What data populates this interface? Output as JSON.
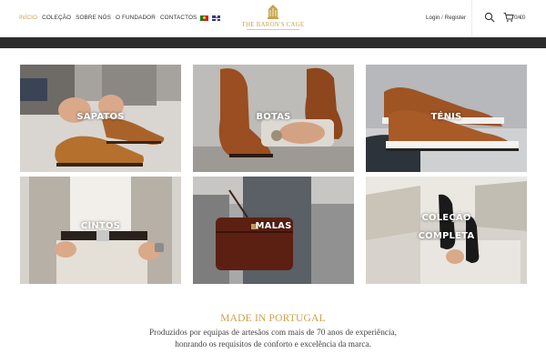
{
  "nav": {
    "items": [
      {
        "label": "Início",
        "active": true
      },
      {
        "label": "Coleção",
        "active": false
      },
      {
        "label": "Sobre Nós",
        "active": false
      },
      {
        "label": "O Fundador",
        "active": false
      },
      {
        "label": "Contactos",
        "active": false
      }
    ],
    "flags": [
      "pt-flag-icon",
      "uk-flag-icon"
    ]
  },
  "logo": {
    "text": "THE BARON'S CAGE",
    "icon": "birdcage-crest-icon"
  },
  "account": {
    "login": "Login",
    "separator": "/",
    "register": "Register"
  },
  "cart": {
    "count": "0",
    "separator": "/",
    "total": "€0",
    "icon": "cart-icon"
  },
  "search": {
    "icon": "search-icon"
  },
  "categories": [
    {
      "label": "Sapatos"
    },
    {
      "label": "Botas"
    },
    {
      "label": "Ténis"
    },
    {
      "label": "Cintos"
    },
    {
      "label": "Malas"
    },
    {
      "label": "Coleção",
      "label2": "Completa"
    }
  ],
  "intro": {
    "title": "MADE IN PORTUGAL",
    "text": "Produzidos por equipas de artesãos com mais de 70 anos de experiência, honrando os requisitos de conforto e excelência da marca."
  },
  "colors": {
    "accent": "#c9a34c",
    "dark_bar": "#2c2c2c",
    "text": "#333333"
  }
}
